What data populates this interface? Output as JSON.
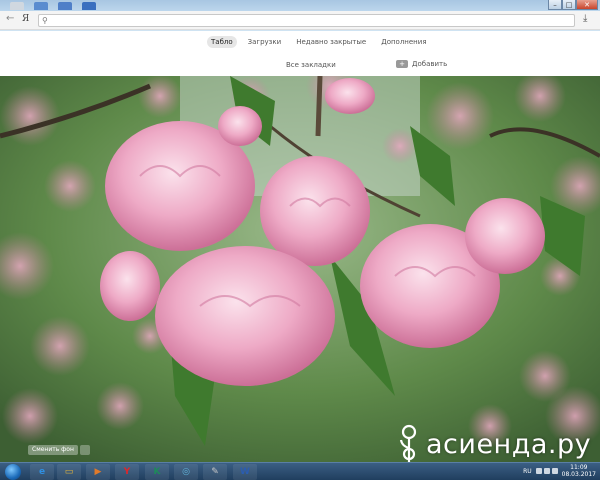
{
  "toolbar": {
    "yandex_glyph": "Я",
    "search_placeholder": ""
  },
  "newtab": {
    "tabs": [
      {
        "label": "Табло",
        "active": true
      },
      {
        "label": "Загрузки",
        "active": false
      },
      {
        "label": "Недавно закрытые",
        "active": false
      },
      {
        "label": "Дополнения",
        "active": false
      }
    ],
    "all_bookmarks": "Все закладки",
    "add_label": "Добавить",
    "add_plus": "+"
  },
  "background": {
    "change_button": "Сменить фон"
  },
  "watermark": {
    "text": "асиенда.ру"
  },
  "taskbar": {
    "apps": [
      {
        "name": "internet-explorer",
        "glyph": "e",
        "color": "#2f8fe0"
      },
      {
        "name": "file-explorer",
        "glyph": "▭",
        "color": "#e2b33a"
      },
      {
        "name": "media-player",
        "glyph": "▶",
        "color": "#e07a2a"
      },
      {
        "name": "yandex-browser",
        "glyph": "Y",
        "color": "#e0262a"
      },
      {
        "name": "kaspersky",
        "glyph": "K",
        "color": "#1e8a5a"
      },
      {
        "name": "network",
        "glyph": "◎",
        "color": "#5fb2d8"
      },
      {
        "name": "tool",
        "glyph": "✎",
        "color": "#c8c8c8"
      },
      {
        "name": "word",
        "glyph": "W",
        "color": "#2b5db0"
      }
    ],
    "language": "RU",
    "time": "11:09",
    "date": "08.03.2017"
  },
  "colors": {
    "accent": "#e6e6e6",
    "taskbar": "#2b4a6e",
    "blossom": "#e48fb2"
  }
}
